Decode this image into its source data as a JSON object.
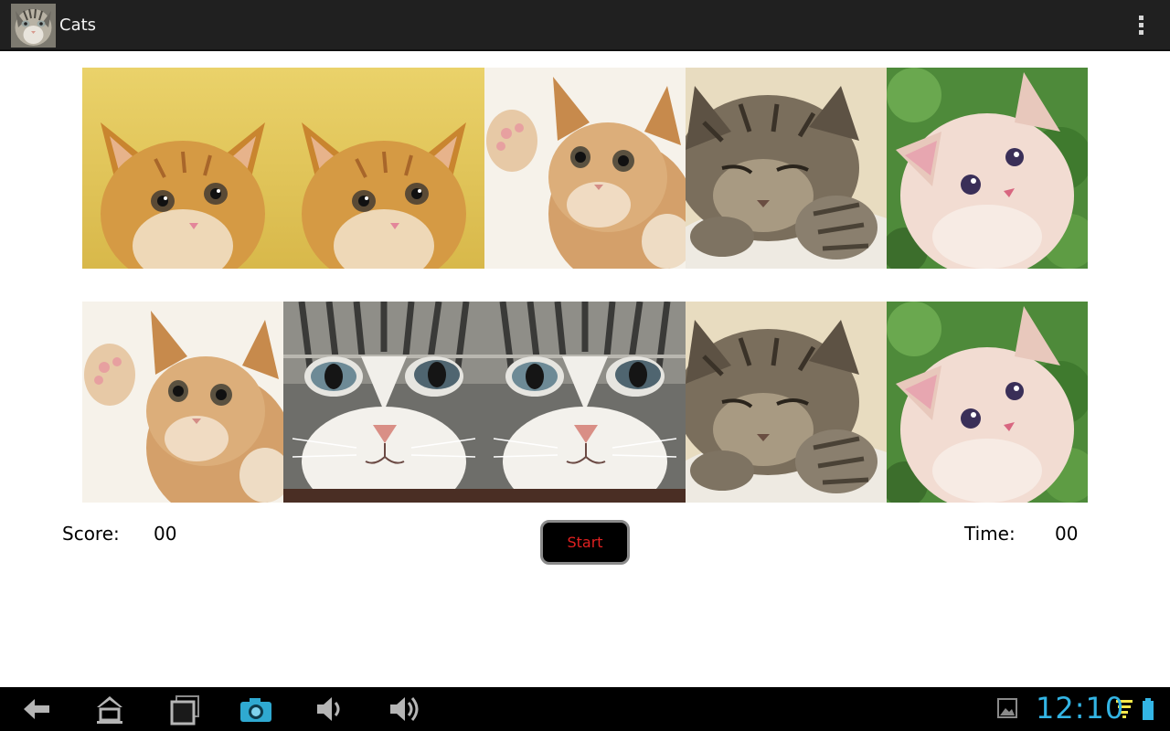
{
  "action_bar": {
    "title": "Cats",
    "app_icon": "cat-app-icon",
    "overflow_icon": "overflow-menu-icon"
  },
  "board": {
    "rows": [
      [
        "orange-kitten-yellow-bg",
        "orange-kitten-yellow-bg",
        "waving-orange-kitten",
        "sleeping-tabby-kitten",
        "fluffy-cream-kitten"
      ],
      [
        "waving-orange-kitten",
        "grey-white-cat-closeup",
        "grey-white-cat-closeup",
        "sleeping-tabby-kitten",
        "fluffy-cream-kitten"
      ]
    ]
  },
  "stats": {
    "score_label": "Score:",
    "score_value": "00",
    "time_label": "Time:",
    "time_value": "00"
  },
  "controls": {
    "start_label": "Start",
    "start_text_color": "#e02020"
  },
  "system_bar": {
    "clock": "12:10",
    "clock_color": "#33b5e5",
    "buttons": [
      "back-icon",
      "home-icon",
      "recent-apps-icon",
      "screenshot-camera-icon",
      "volume-down-icon",
      "volume-up-icon"
    ],
    "status_icons": [
      "gallery-notification-icon",
      "wifi-icon",
      "battery-icon"
    ]
  }
}
